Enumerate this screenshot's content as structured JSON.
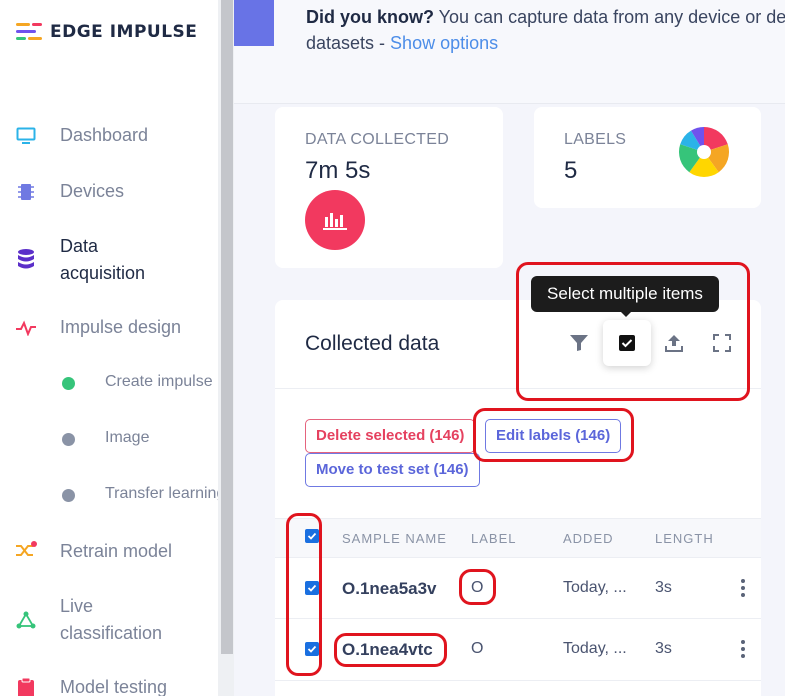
{
  "brand": {
    "name": "EDGE IMPULSE",
    "colors": [
      "#f5a623",
      "#f2395f",
      "#6f52ed",
      "#36c47a"
    ]
  },
  "sidebar": {
    "items": [
      {
        "label": "Dashboard",
        "icon": "monitor-icon",
        "color": "#2bb3e8"
      },
      {
        "label": "Devices",
        "icon": "chip-icon",
        "color": "#6f79e2"
      },
      {
        "label": "Data acquisition",
        "icon": "database-icon",
        "color": "#5b2fc9",
        "active": true
      },
      {
        "label": "Impulse design",
        "icon": "pulse-icon",
        "color": "#f2395f"
      },
      {
        "label": "Retrain model",
        "icon": "shuffle-icon",
        "color": "#f5a623"
      },
      {
        "label": "Live classification",
        "icon": "network-icon",
        "color": "#36c47a"
      },
      {
        "label": "Model testing",
        "icon": "clipboard-icon",
        "color": "#f2395f"
      }
    ],
    "subitems": [
      {
        "label": "Create impulse",
        "status": "green"
      },
      {
        "label": "Image",
        "status": "gray"
      },
      {
        "label": "Transfer learning",
        "status": "gray"
      }
    ]
  },
  "banner": {
    "strong": "Did you know?",
    "text": " You can capture data from any device or de",
    "text2": "datasets - ",
    "link": "Show options"
  },
  "cards": {
    "data_collected": {
      "title": "DATA COLLECTED",
      "value": "7m 5s"
    },
    "labels": {
      "title": "LABELS",
      "value": "5",
      "pie_colors": [
        "#f2395f",
        "#f5a623",
        "#ffd600",
        "#36c47a",
        "#2bb3e8",
        "#6f52ed"
      ]
    }
  },
  "panel": {
    "title": "Collected data",
    "tooltip": "Select multiple items",
    "tools": [
      "filter-icon",
      "select-multiple-icon",
      "upload-icon",
      "fullscreen-icon"
    ],
    "actions": {
      "delete": "Delete selected (146)",
      "edit": "Edit labels (146)",
      "move": "Move to test set (146)"
    }
  },
  "table": {
    "headers": [
      "SAMPLE NAME",
      "LABEL",
      "ADDED",
      "LENGTH"
    ],
    "rows": [
      {
        "name": "O.1nea5a3v",
        "label": "O",
        "added": "Today, ...",
        "length": "3s",
        "checked": true
      },
      {
        "name": "O.1nea4vtc",
        "label": "O",
        "added": "Today, ...",
        "length": "3s",
        "checked": true
      }
    ]
  }
}
